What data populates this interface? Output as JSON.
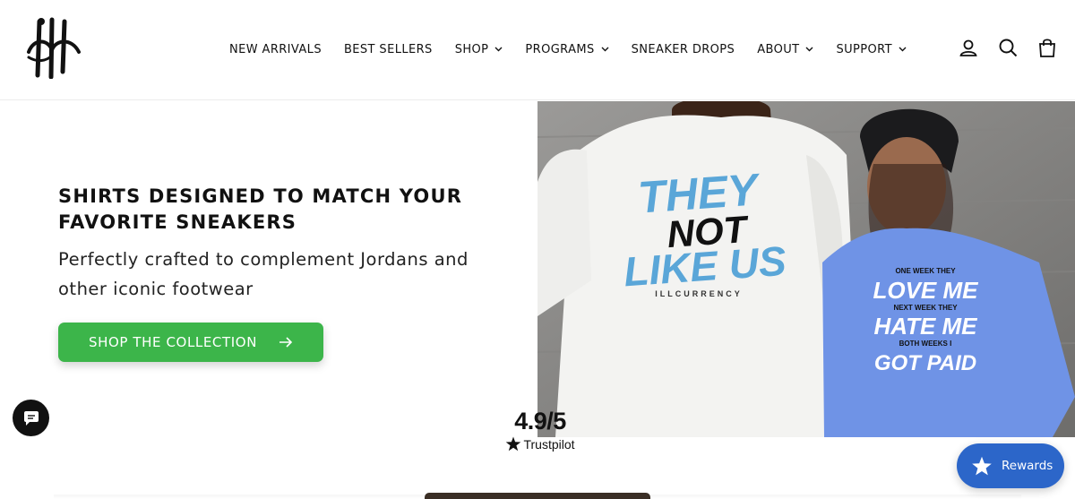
{
  "header": {
    "nav": [
      {
        "label": "NEW ARRIVALS",
        "dropdown": false
      },
      {
        "label": "BEST SELLERS",
        "dropdown": false
      },
      {
        "label": "SHOP",
        "dropdown": true
      },
      {
        "label": "PROGRAMS",
        "dropdown": true
      },
      {
        "label": "SNEAKER DROPS",
        "dropdown": false
      },
      {
        "label": "ABOUT",
        "dropdown": true
      },
      {
        "label": "SUPPORT",
        "dropdown": true
      }
    ],
    "icons": [
      "account-icon",
      "search-icon",
      "cart-icon"
    ]
  },
  "hero": {
    "title": "SHIRTS DESIGNED TO MATCH YOUR FAVORITE SNEAKERS",
    "subtitle": "Perfectly crafted to complement Jordans and other iconic footwear",
    "cta_label": "SHOP THE COLLECTION",
    "shirt_left": {
      "line1": "THEY",
      "line2": "NOT",
      "line3": "LIKE US",
      "brand": "ILLCURRENCY"
    },
    "shirt_right": {
      "line1": "ONE WEEK THEY",
      "line2": "LOVE ME",
      "line3": "NEXT WEEK THEY",
      "line4": "HATE ME",
      "line5": "BOTH WEEKS I",
      "line6": "GOT PAID"
    }
  },
  "trustpilot": {
    "score": "4.9/5",
    "brand": "Trustpilot"
  },
  "rewards": {
    "label": "Rewards"
  },
  "colors": {
    "cta": "#3cb54a",
    "rewards": "#2c66c9",
    "shirt_blue": "#6f93e6",
    "print_blue": "#5aa6d8"
  }
}
